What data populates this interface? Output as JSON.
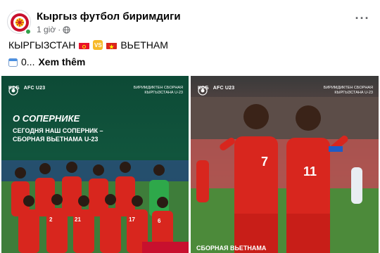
{
  "post": {
    "page_name": "Кыргыз футбол биримдиги",
    "time": "1 giờ",
    "headline_left": "КЫРГЫЗСТАН",
    "headline_right": "ВЬЕТНАМ",
    "vs_text": "VS",
    "second_line_text": "0...",
    "see_more": "Xem thêm"
  },
  "left_image": {
    "brand": "КФБ",
    "tournament": "AFC U23",
    "corner_caption": "БИРИМДИКТЕН СБОРНАЯ\nКЫРГЫЗСТАНА U-23",
    "title": "О СОПЕРНИКЕ",
    "subtitle": "СЕГОДНЯ НАШ СОПЕРНИК –\nСБОРНАЯ ВЬЕТНАМА U-23",
    "jersey_numbers": [
      "21",
      "2",
      "17",
      "6"
    ]
  },
  "right_image": {
    "brand": "КФБ",
    "tournament": "AFC U23",
    "corner_caption": "БИРИМДИКТЕН СБОРНАЯ\nКЫРГЫЗСТАНА U-23",
    "jersey_numbers": [
      "7",
      "11"
    ],
    "caption": "СБОРНАЯ ВЬЕТНАМА"
  },
  "colors": {
    "kg_red": "#e8112d",
    "kg_yellow": "#ffd700",
    "vn_red": "#da251d",
    "vn_yellow": "#ffff00",
    "vs_orange": "#f7b928",
    "meta_gray": "#65676b"
  },
  "icons": {
    "globe": "globe-icon",
    "more": "more-icon",
    "calendar": "calendar-icon"
  }
}
